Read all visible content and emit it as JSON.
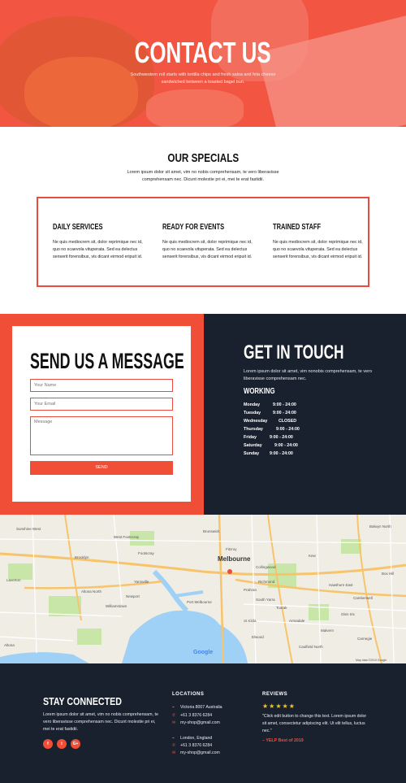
{
  "hero": {
    "title": "CONTACT US",
    "subtitle": "Southwestern roll starts with tortilla chips and fresh salsa and feta cheese sandwiched between a toasted bagel bun."
  },
  "specials": {
    "title": "OUR SPECIALS",
    "description": "Lorem ipsum dolor sit amet, vim no nobis comprehensam, te vero liberavisse comprehensam nec. Dicunt molestie pri ei, mei te erat fastidii.",
    "items": [
      {
        "title": "DAILY SERVICES",
        "text": "Ne quis mediocrem sit, dolor reprimique nec id, quo no scaevola vituperata. Sed ea delectus senserit forensibus, vis dicant eirmod eripuit id."
      },
      {
        "title": "READY FOR EVENTS",
        "text": "Ne quis mediocrem sit, dolor reprimique nec id, quo no scaevola vituperata. Sed ea delectus senserit forensibus, vis dicant eirmod eripuit id."
      },
      {
        "title": "TRAINED STAFF",
        "text": "Ne quis mediocrem sit, dolor reprimique nec id, quo no scaevola vituperata. Sed ea delectus senserit forensibus, vis dicant eirmod eripuit id."
      }
    ]
  },
  "message_form": {
    "title": "SEND US A MESSAGE",
    "name_placeholder": "Your Name",
    "email_placeholder": "Your Email",
    "message_placeholder": "Message",
    "send_label": "SEND"
  },
  "touch": {
    "title": "GET IN TOUCH",
    "description": "Lorem ipsum dolor sit amet, vim nonobis comprehensam, te vero liberavisse comprehensam nec.",
    "working_title": "WORKING",
    "hours": [
      {
        "day": "Monday",
        "time": "9:00 - 24:00"
      },
      {
        "day": "Tuesday",
        "time": "9:00 - 24:00"
      },
      {
        "day": "Wednesday",
        "time": "CLOSED"
      },
      {
        "day": "Thursday",
        "time": "9:00 - 24:00"
      },
      {
        "day": "Friday",
        "time": "9:00 - 24:00"
      },
      {
        "day": "Saturday",
        "time": "9:00 - 24:00"
      },
      {
        "day": "Sunday",
        "time": "9:00 - 24:00"
      }
    ]
  },
  "map": {
    "city_label": "Melbourne",
    "google_label": "Google",
    "data_label": "Map data ©2019 Google",
    "labels": [
      "Sunshine West",
      "West Footscray",
      "Footscray",
      "Yarraville",
      "Williamstown",
      "Newport",
      "Altona North",
      "Brooklyn",
      "Port Melbourne",
      "South Yarra",
      "St Kilda",
      "Elwood",
      "Caulfield North",
      "Hawthorn East",
      "Kew",
      "Box Hill",
      "Collingwood",
      "Fitzroy",
      "Brunswick",
      "Altona",
      "Laverton",
      "Balwyn North",
      "Glen Iris",
      "Malvern",
      "Carnegie",
      "Armadale",
      "Toorak",
      "Richmond",
      "Prahran",
      "Camberwell"
    ]
  },
  "footer": {
    "stay_title": "STAY CONNECTED",
    "stay_desc": "Lorem ipsum dolor sit amet, vim no nobis comprehensam, te vero liberavisse comprehensam nec. Dicunt molestie pri ei, mei te erat fastidii.",
    "social": [
      {
        "icon": "facebook-icon",
        "glyph": "f"
      },
      {
        "icon": "twitter-icon",
        "glyph": "t"
      },
      {
        "icon": "google-plus-icon",
        "glyph": "G+"
      }
    ],
    "locations_title": "LOCATIONS",
    "locations": [
      {
        "address": "Victoria 8007 Australia",
        "phone": "+61 3 8376 6284",
        "email": "my-shop@gmail.com"
      },
      {
        "address": "London, England",
        "phone": "+61 3 8376 6284",
        "email": "my-shop@gmail.com"
      }
    ],
    "reviews_title": "REVIEWS",
    "stars": "★★★★★",
    "review_text": "\"Click edit button to change this text. Lorem ipsum dolor sit amet, consectetur adipiscing elit. Ut elit tellus, luctus nec.\"",
    "review_author": "– YELP Best of 2019"
  },
  "colors": {
    "accent": "#f04e37",
    "dark": "#19212f",
    "star": "#f5c518"
  }
}
